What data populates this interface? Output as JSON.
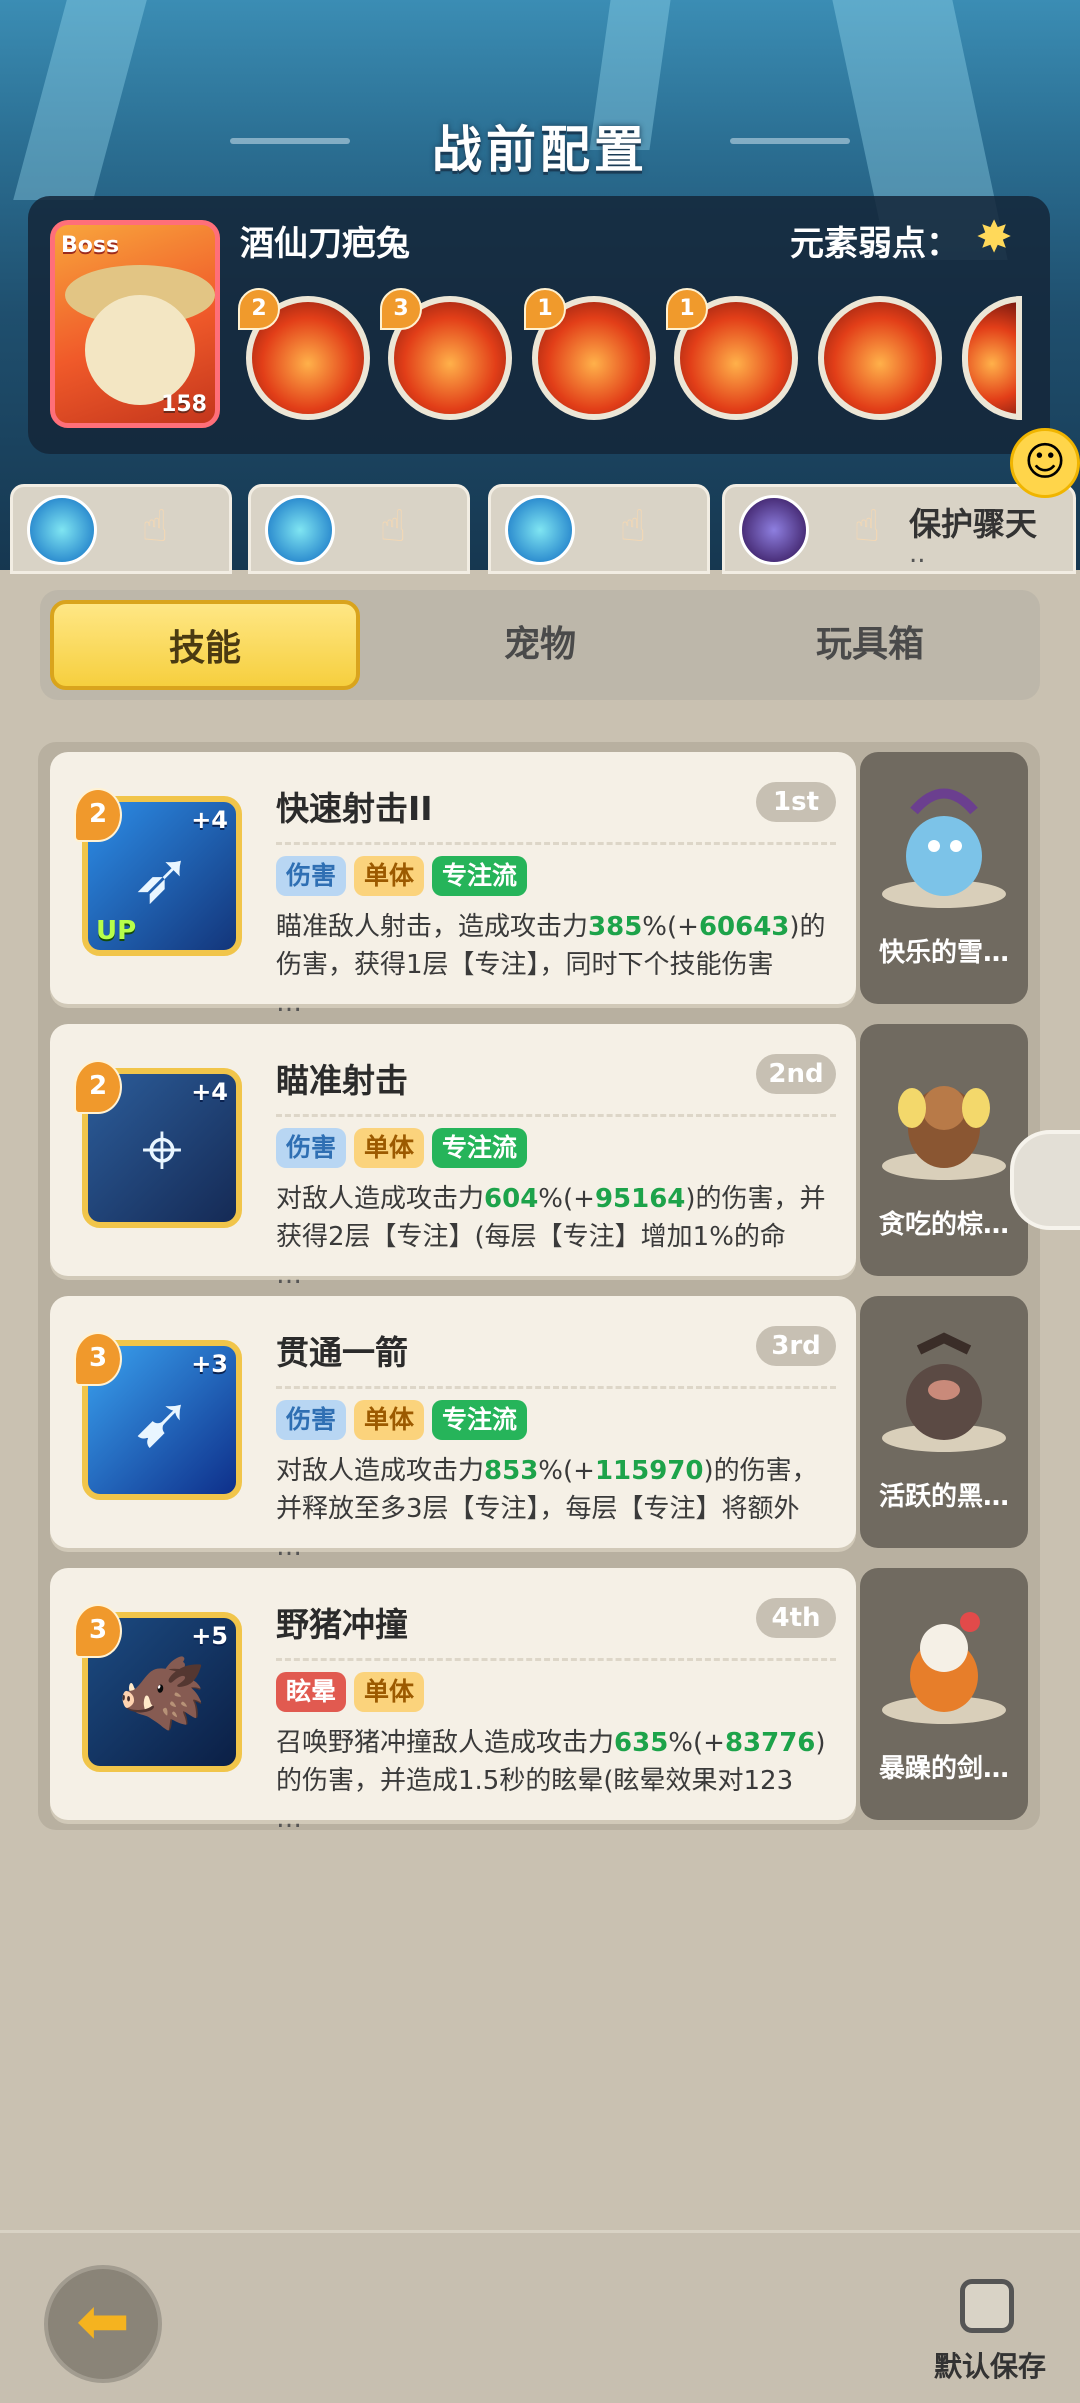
{
  "header": {
    "title": "战前配置",
    "boss": {
      "tag": "Boss",
      "name": "酒仙刀疤兔",
      "level": "158",
      "weakness_label": "元素弱点：",
      "weakness_icon": "star-burst-icon"
    },
    "boss_skills": [
      {
        "level": "2"
      },
      {
        "level": "3"
      },
      {
        "level": "1"
      },
      {
        "level": "1"
      },
      {
        "level": ""
      }
    ]
  },
  "team": {
    "chat_label": "保护骤天",
    "chat_sub": ".."
  },
  "tabs": [
    "技能",
    "宠物",
    "玩具箱"
  ],
  "skills": [
    {
      "level": "2",
      "plus": "+4",
      "up": "UP",
      "name": "快速射击II",
      "rank": "1st",
      "tags": [
        "伤害",
        "单体",
        "专注流"
      ],
      "desc_pre": "瞄准敌人射击，造成攻击力",
      "desc_hl1": "385",
      "desc_mid": "%(+",
      "desc_hl2": "60643",
      "desc_post": ")的伤害，获得1层【专注】，同时下个技能伤害",
      "dots": "…",
      "pet": "快乐的雪…"
    },
    {
      "level": "2",
      "plus": "+4",
      "up": "",
      "name": "瞄准射击",
      "rank": "2nd",
      "tags": [
        "伤害",
        "单体",
        "专注流"
      ],
      "desc_pre": "对敌人造成攻击力",
      "desc_hl1": "604",
      "desc_mid": "%(+",
      "desc_hl2": "95164",
      "desc_post": ")的伤害，并获得2层【专注】(每层【专注】增加1%的命",
      "dots": "…",
      "pet": "贪吃的棕…"
    },
    {
      "level": "3",
      "plus": "+3",
      "up": "",
      "name": "贯通一箭",
      "rank": "3rd",
      "tags": [
        "伤害",
        "单体",
        "专注流"
      ],
      "desc_pre": "对敌人造成攻击力",
      "desc_hl1": "853",
      "desc_mid": "%(+",
      "desc_hl2": "115970",
      "desc_post": ")的伤害，并释放至多3层【专注】，每层【专注】将额外",
      "dots": "…",
      "pet": "活跃的黑…"
    },
    {
      "level": "3",
      "plus": "+5",
      "up": "",
      "name": "野猪冲撞",
      "rank": "4th",
      "tags": [
        "眩晕",
        "单体"
      ],
      "desc_pre": "召唤野猪冲撞敌人造成攻击力",
      "desc_hl1": "635",
      "desc_mid": "%(+",
      "desc_hl2": "83776",
      "desc_post": ")的伤害，并造成1.5秒的眩晕(眩晕效果对123",
      "dots": "…",
      "pet": "暴躁的剑…"
    }
  ],
  "footer": {
    "back_icon": "back-arrow-icon",
    "save_label": "默认保存"
  },
  "colors": {
    "accent_yellow": "#f6cf3e",
    "tag_green": "#26b45a",
    "tag_blue": "#b8d6f3",
    "tag_orange": "#fbd37c",
    "tag_red": "#e15a50"
  }
}
